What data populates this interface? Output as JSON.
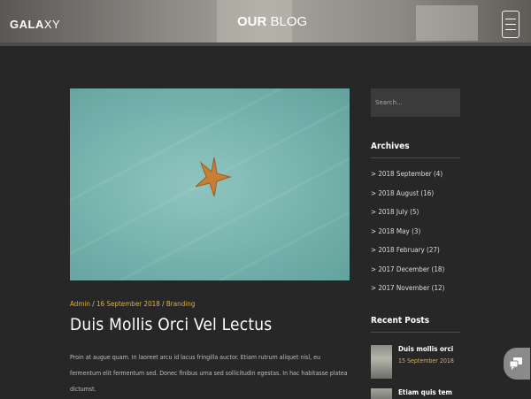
{
  "header": {
    "logo": {
      "bold": "GALA",
      "light": "XY"
    },
    "title": {
      "bold": "OUR",
      "light": "BLOG"
    },
    "menu_icon": "hamburger-menu-icon"
  },
  "post": {
    "image_alt": "starfish-on-sand-image",
    "meta": {
      "author": "Admin",
      "date": "16 September 2018",
      "category": "Branding",
      "separator": "/"
    },
    "title": "Duis Mollis Orci Vel Lectus",
    "excerpt": "Proin at augue quam. In laoreet arcu id lacus fringilla auctor. Etiam rutrum aliquet nisl, eu fermentum elit fermentum sed. Donec finibus urna sed sollicitudin egestas. In hac habitasse platea dictumst."
  },
  "sidebar": {
    "search": {
      "placeholder": "Search..."
    },
    "archives": {
      "title": "Archives",
      "items": [
        "> 2018 September (4)",
        "> 2018 August (16)",
        "> 2018 July (5)",
        "> 2018 May (3)",
        "> 2018 February (27)",
        "> 2017 December (18)",
        "> 2017 November (12)"
      ]
    },
    "recent_posts": {
      "title": "Recent Posts",
      "items": [
        {
          "title": "Duis mollis orci",
          "date": "15 September 2018"
        },
        {
          "title": "Etiam quis tem",
          "date": ""
        }
      ]
    }
  },
  "chat": {
    "icon": "chat-bubbles-icon"
  },
  "colors": {
    "accent": "#d8b24a",
    "background": "#272727",
    "panel": "#3b3b3b"
  }
}
